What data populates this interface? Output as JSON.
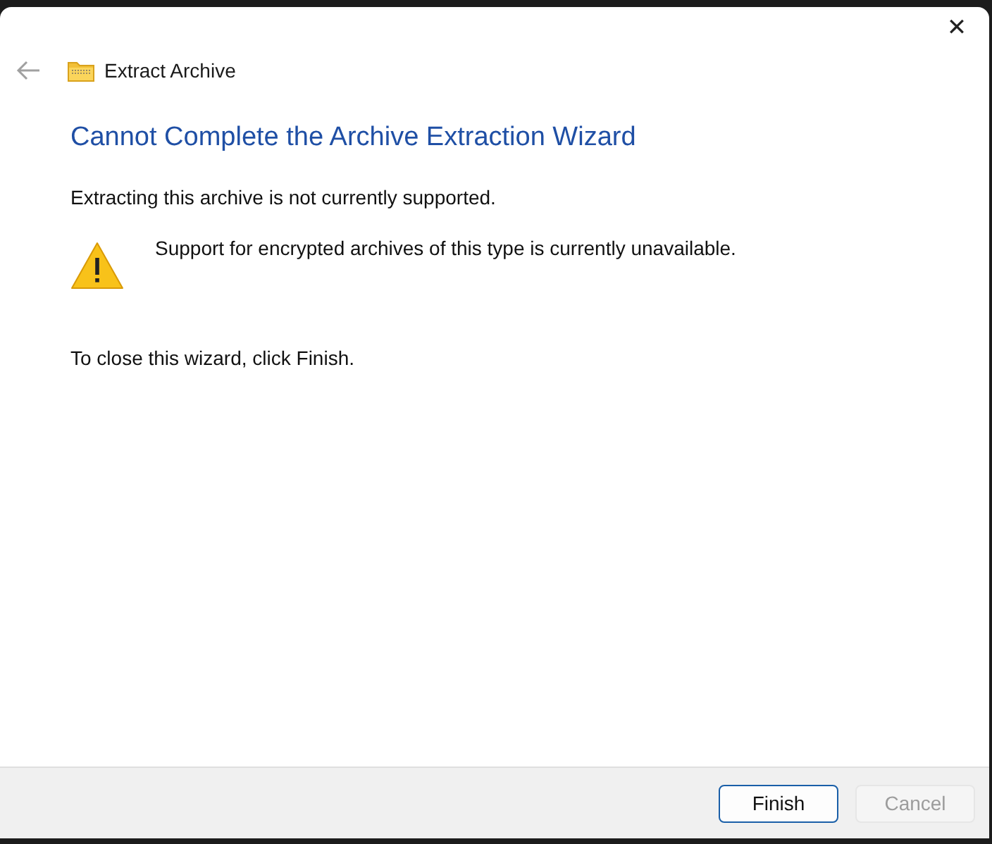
{
  "window": {
    "title": "Extract Archive",
    "close": "✕"
  },
  "back_button": {
    "disabled": true
  },
  "heading": "Cannot Complete the Archive Extraction Wizard",
  "message": "Extracting this archive is not currently supported.",
  "warning": {
    "text": "Support for encrypted archives of this type is currently unavailable."
  },
  "instruction": "To close this wizard, click Finish.",
  "buttons": [
    {
      "label": "Finish",
      "default": true,
      "disabled": false
    },
    {
      "label": "Cancel",
      "default": false,
      "disabled": true
    }
  ]
}
